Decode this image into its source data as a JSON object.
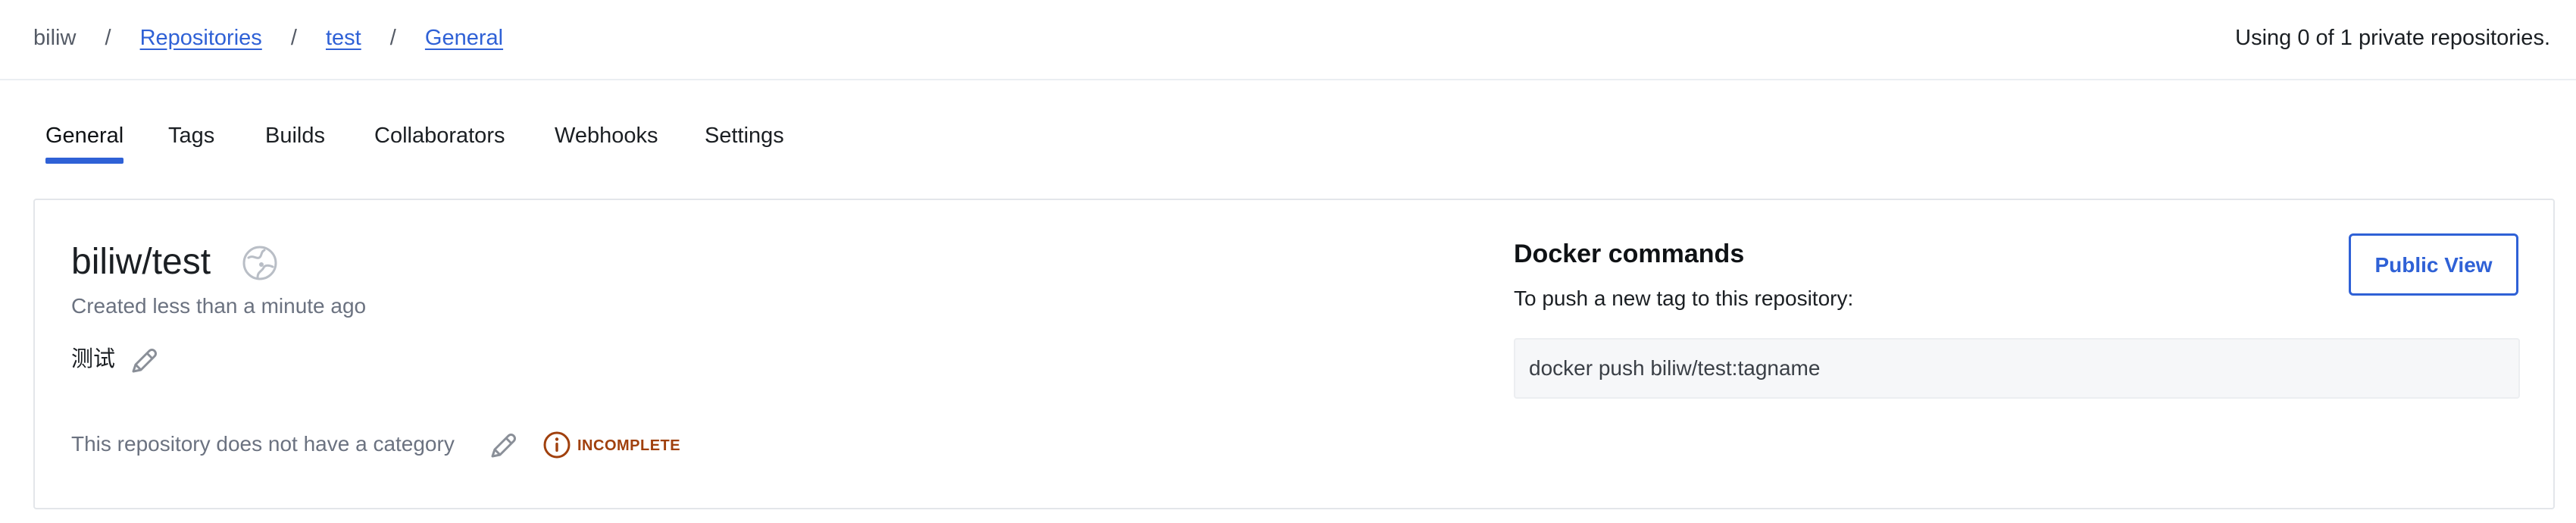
{
  "breadcrumb": {
    "owner": "biliw",
    "separator": "/",
    "items": [
      {
        "label": "Repositories"
      },
      {
        "label": "test"
      },
      {
        "label": "General"
      }
    ]
  },
  "usage_text": "Using 0 of 1 private repositories.",
  "tabs": [
    {
      "label": "General",
      "active": true
    },
    {
      "label": "Tags"
    },
    {
      "label": "Builds"
    },
    {
      "label": "Collaborators"
    },
    {
      "label": "Webhooks"
    },
    {
      "label": "Settings"
    }
  ],
  "repo": {
    "name": "biliw/test",
    "visibility_icon": "globe-icon",
    "created": "Created less than a minute ago",
    "description": "测试",
    "category_text": "This repository does not have a category",
    "status_badge": "INCOMPLETE"
  },
  "docker": {
    "title": "Docker commands",
    "subtitle": "To push a new tag to this repository:",
    "command": "docker push biliw/test:tagname",
    "public_view_label": "Public View"
  },
  "colors": {
    "accent": "#2f61d6",
    "warning": "#a0400d",
    "muted_text": "#6b7280"
  }
}
